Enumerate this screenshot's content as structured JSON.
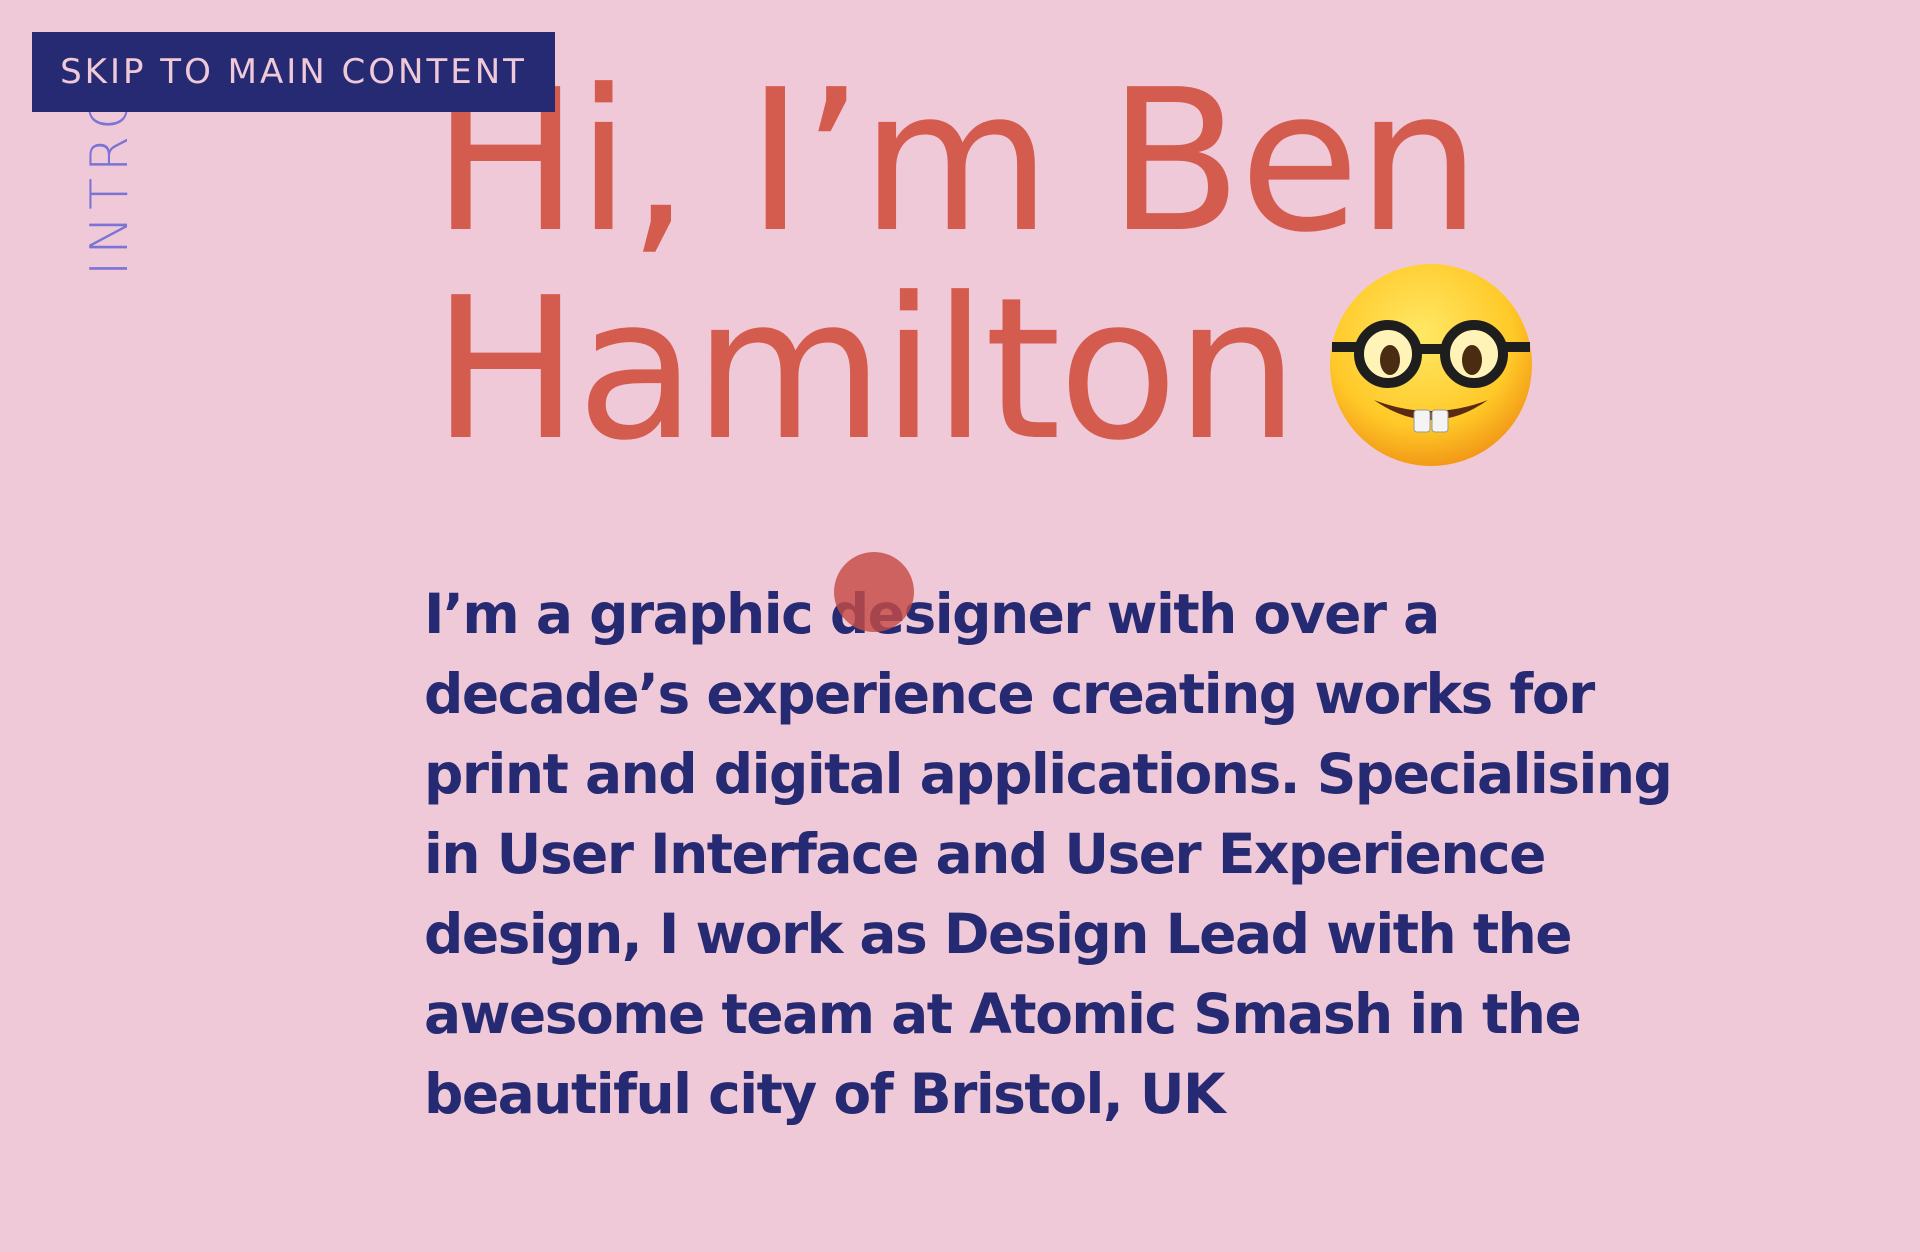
{
  "skip_link": {
    "label": "SKIP TO MAIN CONTENT"
  },
  "section": {
    "label": "INTRO"
  },
  "hero": {
    "heading_lines": [
      "Hi, I’m Ben",
      "Hamilton"
    ],
    "emoji": "nerd-face-icon"
  },
  "intro": {
    "lines": [
      "I’m a graphic designer with over a",
      "decade’s experience creating works for",
      "print and digital applications. Specialising",
      "in User Interface and User Experience",
      "design, I work as Design Lead with the",
      "awesome team at Atomic Smash in the",
      "beautiful city of Bristol, UK"
    ]
  },
  "colors": {
    "background": "#f0c9d8",
    "heading": "#d45c4e",
    "body_text": "#262a73",
    "skip_link_bg": "#262a73",
    "section_label": "#7b74d6",
    "cursor_dot": "#c44c46"
  }
}
